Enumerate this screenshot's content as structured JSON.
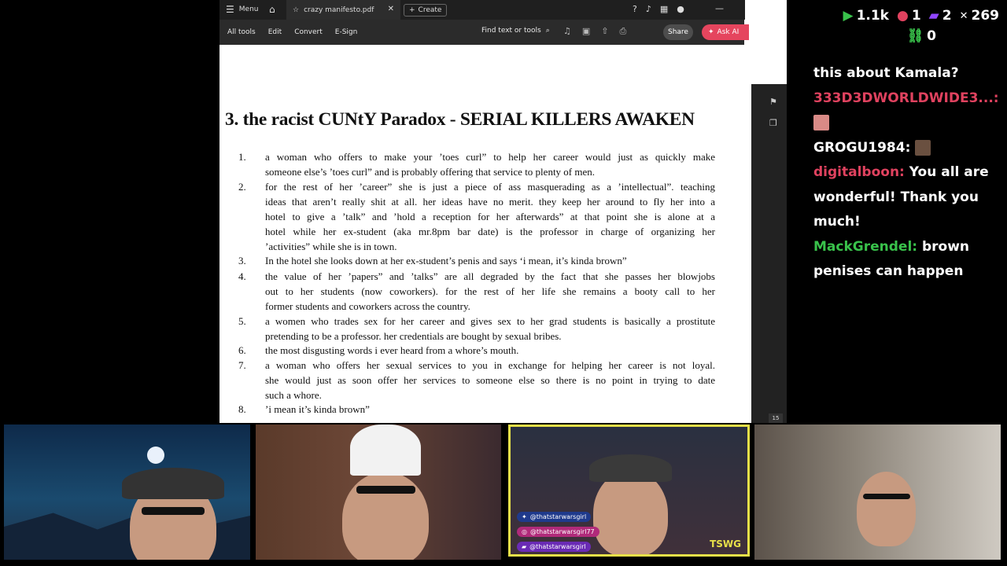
{
  "viewer": {
    "menu_label": "Menu",
    "tab_title": "crazy manifesto.pdf",
    "create_label": "Create",
    "tools": [
      "All tools",
      "Edit",
      "Convert",
      "E-Sign"
    ],
    "find_label": "Find text or tools",
    "share_label": "Share",
    "ask_ai_label": "Ask AI",
    "page_number": "15"
  },
  "document": {
    "heading": "3. the racist CUNtY Paradox - SERIAL KILLERS AWAKEN",
    "items": [
      {
        "num": "1.",
        "lines": [
          "a woman who offers to make your ’toes curl” to help her career would just as quickly make",
          "someone else’s ’toes curl” and is probably offering that service to plenty of men."
        ]
      },
      {
        "num": "2.",
        "lines": [
          "for the rest of her ’career” she is just a piece of ass masquerading as a ’intellectual”. teaching",
          "ideas that aren’t really shit at all. her ideas have no merit. they keep her around to fly her into a",
          "hotel to give a ’talk” and ’hold a reception for her afterwards” at that point she is alone at a",
          "hotel while her ex-student (aka mr.8pm bar date) is the professor in charge of organizing her",
          "’activities” while she is in town."
        ]
      },
      {
        "num": "3.",
        "lines": [
          "In the hotel she looks down at her ex-student’s penis and says ‘i mean, it’s kinda brown”"
        ]
      },
      {
        "num": "4.",
        "lines": [
          "the value of her ’papers” and ’talks” are all degraded by the fact that she passes her blowjobs",
          "out to her students (now coworkers). for the rest of her life she remains a booty call to her",
          "former students and coworkers across the country."
        ]
      },
      {
        "num": "5.",
        "lines": [
          "a women who trades sex for her career and gives sex to her grad students is basically a prostitute",
          "pretending to be a professor. her credentials are bought by sexual bribes."
        ]
      },
      {
        "num": "6.",
        "lines": [
          "the most disgusting words i ever heard from a whore’s mouth."
        ]
      },
      {
        "num": "7.",
        "lines": [
          "a woman who offers her sexual services to you in exchange for helping her career is not loyal.",
          "she would just as soon offer her services to someone else so there is no point in trying to date",
          "such a whore."
        ]
      },
      {
        "num": "8.",
        "lines": [
          "’i mean it’s kinda brown”"
        ]
      }
    ]
  },
  "stats": {
    "viewers": "1.1k",
    "red_count": "1",
    "twitch_count": "2",
    "x_count": "269",
    "link_count": "0"
  },
  "chat": [
    {
      "user": "",
      "text": "this about Kamala?",
      "color": "#ffffff"
    },
    {
      "user": "333D3DWORLDWIDE3...:",
      "text": "",
      "color": "#e0425f",
      "emote": true
    },
    {
      "user": "GROGU1984:",
      "text": "",
      "color": "#ffffff",
      "emote": true
    },
    {
      "user": "digitalboon:",
      "text": "You all are wonderful! Thank you much!",
      "color": "#e0425f"
    },
    {
      "user": "MackGrendel:",
      "text": "brown penises can happen",
      "color": "#39c24b"
    }
  ],
  "cam3_handles": [
    "@thatstarwarsgirl",
    "@thatstarwarsgirl77",
    "@thatstarwarsgirl"
  ],
  "cam3_logo": "TSWG",
  "colors": {
    "accent_red": "#e5455e",
    "chat_red": "#e0425f",
    "chat_green": "#39c24b",
    "cam_border": "#e7e049"
  }
}
